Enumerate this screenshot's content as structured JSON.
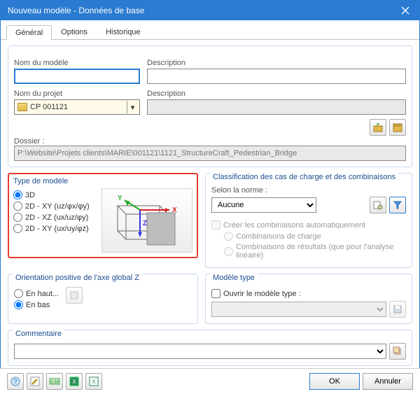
{
  "window": {
    "title": "Nouveau modèle - Données de base"
  },
  "tabs": {
    "general": "Général",
    "options": "Options",
    "history": "Historique"
  },
  "fields": {
    "model_name_label": "Nom du modèle",
    "model_name_value": "",
    "description1_label": "Description",
    "description1_value": "",
    "project_name_label": "Nom du projet",
    "project_name_value": "CP 001121",
    "description2_label": "Description",
    "description2_value": "",
    "folder_label": "Dossier :",
    "folder_value": "P:\\Website\\Projets clients\\MARIE\\001121\\1121_StructureCraft_Pedestrian_Bridge"
  },
  "model_type": {
    "legend": "Type de modèle",
    "opt_3d": "3D",
    "opt_xy1": "2D - XY (uz/φx/φy)",
    "opt_xz": "2D - XZ (ux/uz/φy)",
    "opt_xy2": "2D - XY (ux/uy/φz)"
  },
  "classification": {
    "legend": "Classification des cas de charge et des combinaisons",
    "norm_label": "Selon la norme :",
    "norm_value": "Aucune",
    "auto_create": "Créer les combinaisons automatiquement",
    "load_comb": "Combinaisons de charge",
    "result_comb": "Combinaisons de résultats (que pour l'analyse linéaire)"
  },
  "orientation": {
    "legend": "Orientation positive de l'axe global Z",
    "up": "En haut...",
    "down": "En bas"
  },
  "template": {
    "legend": "Modèle type",
    "open": "Ouvrir le modèle type :"
  },
  "comment": {
    "legend": "Commentaire",
    "value": ""
  },
  "buttons": {
    "ok": "OK",
    "cancel": "Annuler"
  }
}
